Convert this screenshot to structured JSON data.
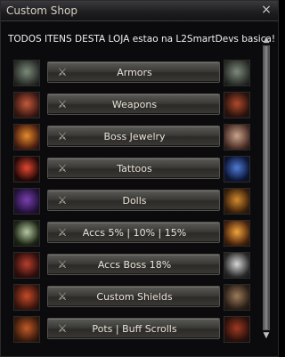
{
  "window": {
    "title": "Custom Shop",
    "close_symbol": "×"
  },
  "banner": {
    "text": "TODOS ITENS DESTA LOJA estao na L2SmartDevs basica!"
  },
  "buttons": [
    {
      "label": "Armors",
      "left_icon": "armor-icon",
      "right_icon": "armor-icon",
      "left_colors": [
        "#7c8a7a",
        "#2b2f2a"
      ],
      "right_colors": [
        "#7c8a7a",
        "#2b2f2a"
      ]
    },
    {
      "label": "Weapons",
      "left_icon": "weapon-icon",
      "right_icon": "pvp-weapon-icon",
      "left_colors": [
        "#c45a3b",
        "#3a1712"
      ],
      "right_colors": [
        "#b04a2b",
        "#2a120d"
      ]
    },
    {
      "label": "Boss Jewelry",
      "left_icon": "necklace-icon",
      "right_icon": "earring-icon",
      "left_colors": [
        "#e58b2c",
        "#4a1d10"
      ],
      "right_colors": [
        "#c9a48b",
        "#4b2d26"
      ]
    },
    {
      "label": "Tattoos",
      "left_icon": "tattoo-red-icon",
      "right_icon": "tattoo-blue-icon",
      "left_colors": [
        "#e34830",
        "#220707"
      ],
      "right_colors": [
        "#4f7bd6",
        "#0b1434"
      ]
    },
    {
      "label": "Dolls",
      "left_icon": "doll-icon",
      "right_icon": "doll-icon",
      "left_colors": [
        "#7a3fb0",
        "#22113a"
      ],
      "right_colors": [
        "#d38a2f",
        "#3a1f09"
      ]
    },
    {
      "label": "Accs 5% | 10% | 15%",
      "left_icon": "mask-icon",
      "right_icon": "hat-icon",
      "left_colors": [
        "#b6c7a3",
        "#1c2514"
      ],
      "right_colors": [
        "#f1a43c",
        "#4a220b"
      ]
    },
    {
      "label": "Accs Boss 18%",
      "left_icon": "dragon-mask-icon",
      "right_icon": "glove-icon",
      "left_colors": [
        "#b5402f",
        "#2e0d0a"
      ],
      "right_colors": [
        "#d7d7d7",
        "#2a2a2a"
      ]
    },
    {
      "label": "Custom Shields",
      "left_icon": "shield-icon",
      "right_icon": "shield-icon",
      "left_colors": [
        "#c44b2a",
        "#3a140c"
      ],
      "right_colors": [
        "#9b7b5b",
        "#2b1f16"
      ]
    },
    {
      "label": "Pots | Buff Scrolls",
      "left_icon": "potion-icon",
      "right_icon": "scroll-icon",
      "left_colors": [
        "#c25a2a",
        "#3a1a0a"
      ],
      "right_colors": [
        "#9e3a23",
        "#2a0f0a"
      ]
    }
  ]
}
